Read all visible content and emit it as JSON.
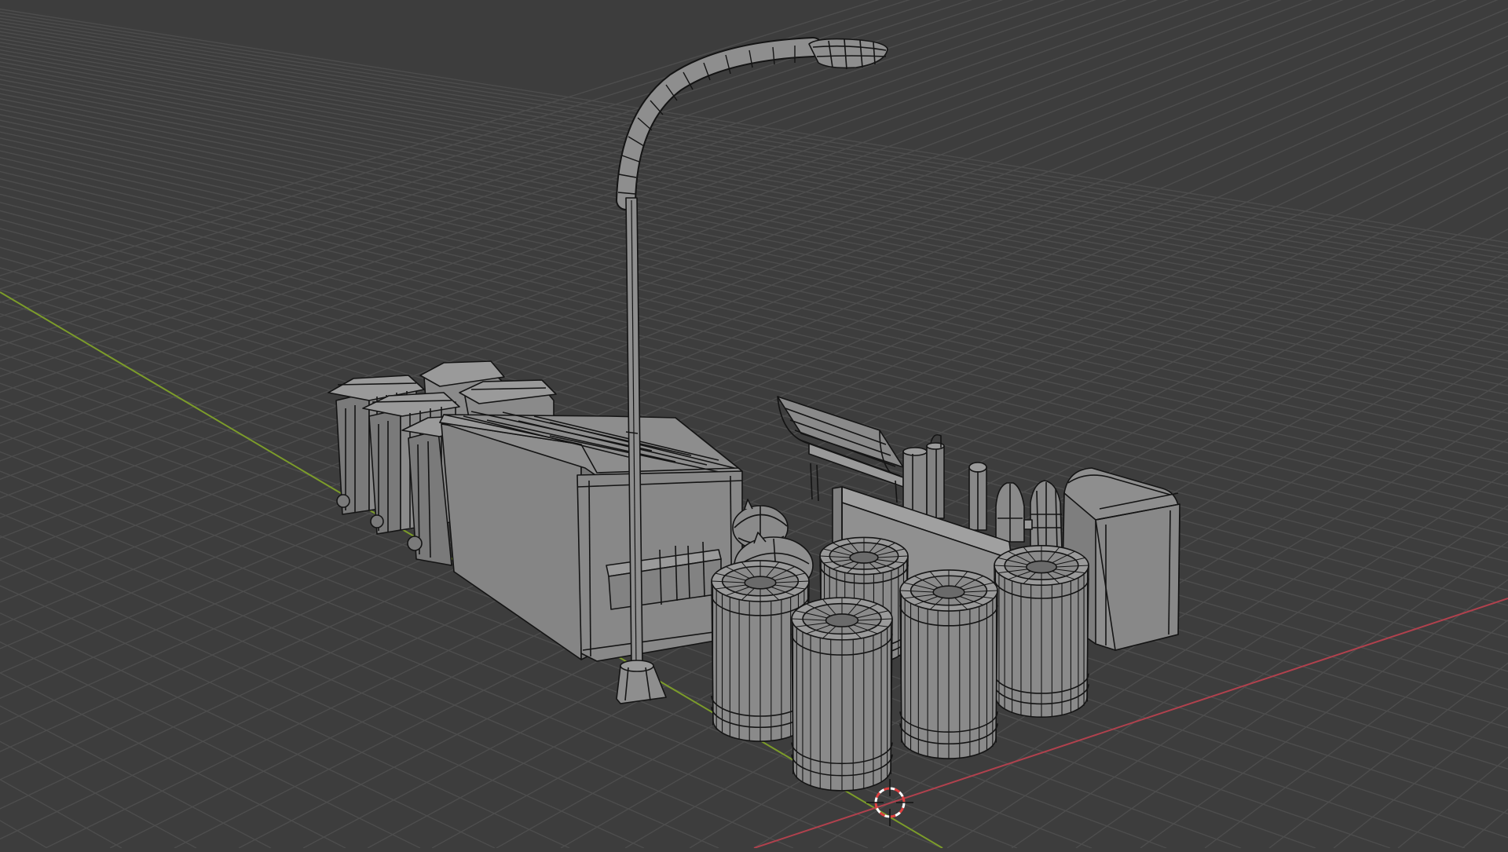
{
  "app": {
    "view": "3D Viewport",
    "shading": "solid-with-wireframe"
  },
  "colors": {
    "background": "#3d3d3d",
    "grid_line": "#4d4d4d",
    "x_axis": "#b0414d",
    "y_axis": "#7c9c2a",
    "mesh_fill": "#8a8a8a",
    "mesh_fill_light": "#9a9a9a",
    "mesh_fill_dark": "#6f6f6f",
    "wire": "#141414",
    "cursor_ring": "#e04040",
    "cursor_white": "#ffffff"
  },
  "scene": {
    "objects": [
      "street-lamp",
      "dumpster",
      "wheelie-bins",
      "garbage-bags",
      "park-bench",
      "concrete-barrier",
      "trash-cans",
      "bollard",
      "fire-hydrant",
      "fire-extinguisher",
      "waste-container"
    ]
  },
  "icons": {
    "cursor": "3d-cursor-icon"
  }
}
